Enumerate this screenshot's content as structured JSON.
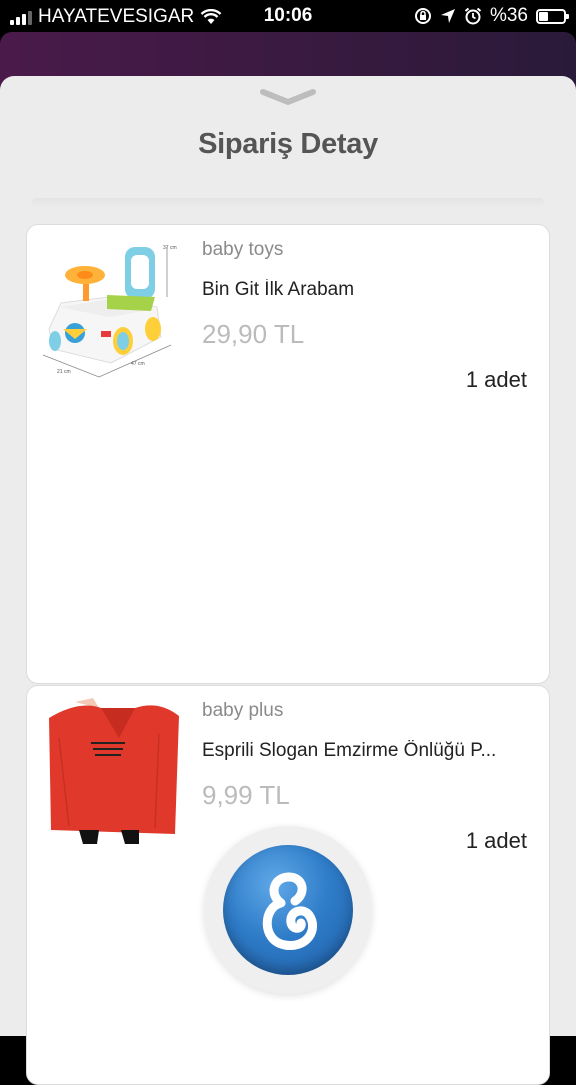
{
  "status_bar": {
    "carrier": "HAYATEVESIGAR",
    "time": "10:06",
    "battery": "%36",
    "battery_level": 0.36
  },
  "sheet": {
    "title": "Sipariş Detay"
  },
  "items": [
    {
      "brand": "baby toys",
      "name": "Bin Git İlk Arabam",
      "price": "29,90 TL",
      "quantity": "1 adet"
    },
    {
      "brand": "baby plus",
      "name": "Esprili Slogan Emzirme Önlüğü P...",
      "price": "9,99 TL",
      "quantity": "1 adet"
    }
  ],
  "colors": {
    "accent_blue": "#2f7cc8",
    "sheet_bg": "#ececec"
  }
}
